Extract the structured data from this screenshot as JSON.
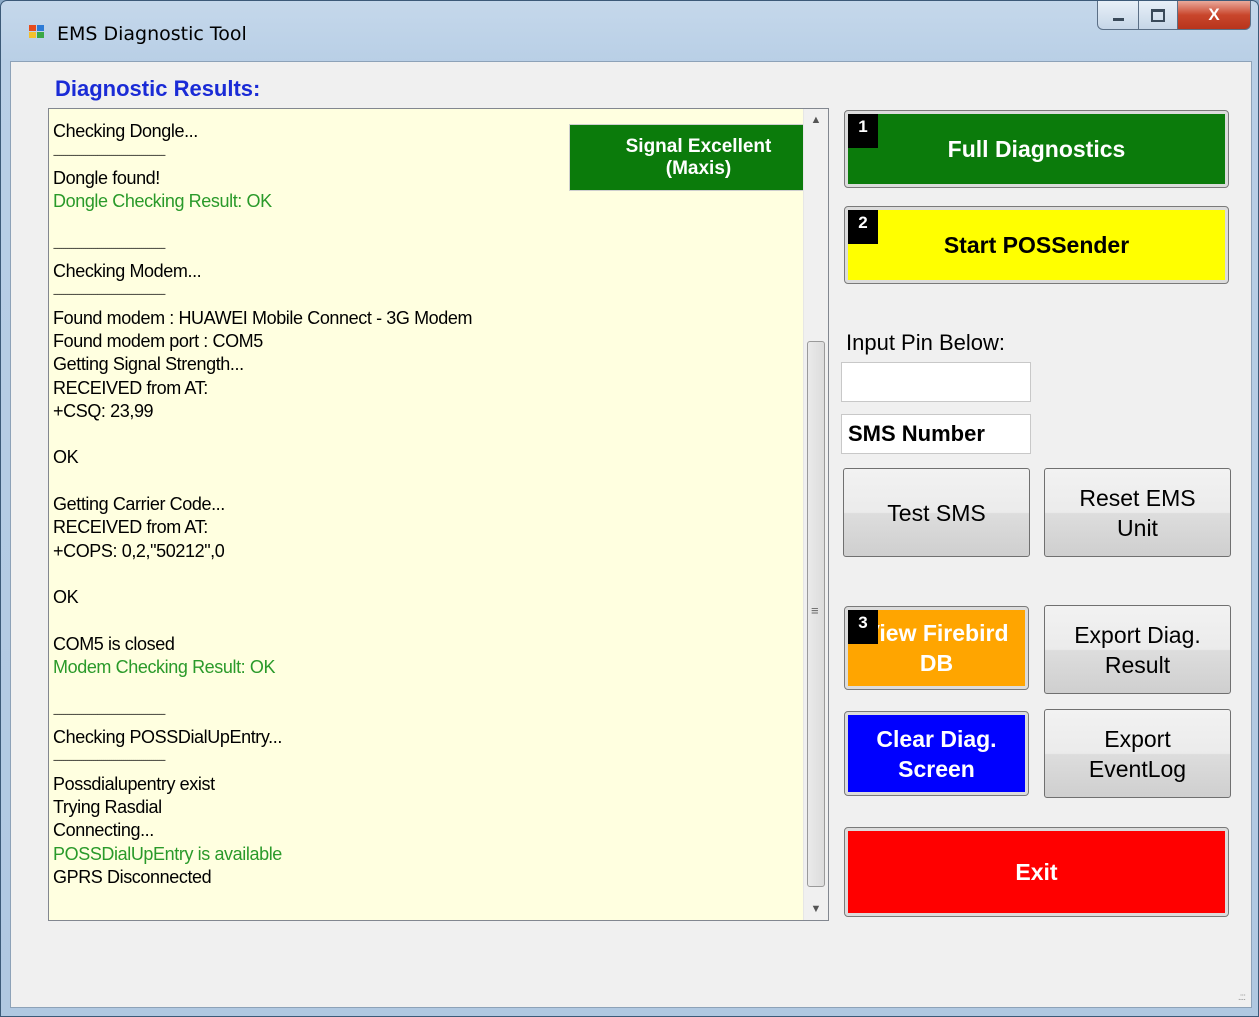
{
  "window": {
    "title": "EMS Diagnostic Tool",
    "close_glyph": "X",
    "min_glyph": "—",
    "max_glyph": "□"
  },
  "heading": "Diagnostic Results:",
  "signal": {
    "label": "Signal Excellent (Maxis)"
  },
  "log": [
    {
      "text": "--------------------------------------------------------",
      "kind": "sep"
    },
    {
      "text": "Checking Dongle...",
      "kind": "normal"
    },
    {
      "text": "--------------------------------------------------------",
      "kind": "sep"
    },
    {
      "text": "Dongle found!",
      "kind": "normal"
    },
    {
      "text": "Dongle Checking Result: OK",
      "kind": "ok"
    },
    {
      "text": "",
      "kind": "normal"
    },
    {
      "text": "--------------------------------------------------------",
      "kind": "sep"
    },
    {
      "text": "Checking Modem...",
      "kind": "normal"
    },
    {
      "text": "--------------------------------------------------------",
      "kind": "sep"
    },
    {
      "text": "Found modem : HUAWEI Mobile Connect - 3G Modem",
      "kind": "normal"
    },
    {
      "text": "Found modem port : COM5",
      "kind": "normal"
    },
    {
      "text": "Getting Signal Strength...",
      "kind": "normal"
    },
    {
      "text": "RECEIVED from AT:",
      "kind": "normal"
    },
    {
      "text": "+CSQ: 23,99",
      "kind": "normal"
    },
    {
      "text": "",
      "kind": "normal"
    },
    {
      "text": "OK",
      "kind": "normal"
    },
    {
      "text": "",
      "kind": "normal"
    },
    {
      "text": "Getting Carrier Code...",
      "kind": "normal"
    },
    {
      "text": "RECEIVED from AT:",
      "kind": "normal"
    },
    {
      "text": "+COPS: 0,2,\"50212\",0",
      "kind": "normal"
    },
    {
      "text": "",
      "kind": "normal"
    },
    {
      "text": "OK",
      "kind": "normal"
    },
    {
      "text": "",
      "kind": "normal"
    },
    {
      "text": "COM5 is closed",
      "kind": "normal"
    },
    {
      "text": "Modem Checking Result: OK",
      "kind": "ok"
    },
    {
      "text": "",
      "kind": "normal"
    },
    {
      "text": "--------------------------------------------------------",
      "kind": "sep"
    },
    {
      "text": "Checking POSSDialUpEntry...",
      "kind": "normal"
    },
    {
      "text": "--------------------------------------------------------",
      "kind": "sep"
    },
    {
      "text": "Possdialupentry exist",
      "kind": "normal"
    },
    {
      "text": "Trying Rasdial",
      "kind": "normal"
    },
    {
      "text": "Connecting...",
      "kind": "normal"
    },
    {
      "text": "POSSDialUpEntry is available",
      "kind": "ok"
    },
    {
      "text": "GPRS Disconnected",
      "kind": "normal"
    }
  ],
  "buttons": {
    "full_diagnostics": {
      "badge": "1",
      "label": "Full Diagnostics"
    },
    "start_possender": {
      "badge": "2",
      "label": "Start POSSender"
    },
    "test_sms": {
      "label": "Test SMS"
    },
    "reset_ems": {
      "label": "Reset EMS Unit"
    },
    "view_firebird": {
      "badge": "3",
      "label": "View Firebird DB"
    },
    "export_diag": {
      "label": "Export Diag. Result"
    },
    "clear_diag": {
      "label": "Clear Diag. Screen"
    },
    "export_eventlog": {
      "label": "Export EventLog"
    },
    "exit": {
      "label": "Exit"
    }
  },
  "pin": {
    "label": "Input Pin Below:",
    "value": ""
  },
  "sms_number": {
    "value": "SMS Number"
  },
  "colors": {
    "green": "#0b7b0b",
    "yellow": "#ffff00",
    "orange": "#ffa500",
    "blue": "#0000ff",
    "red": "#ff0000",
    "ok_text": "#2a9a2a",
    "heading": "#1a2bd6"
  }
}
